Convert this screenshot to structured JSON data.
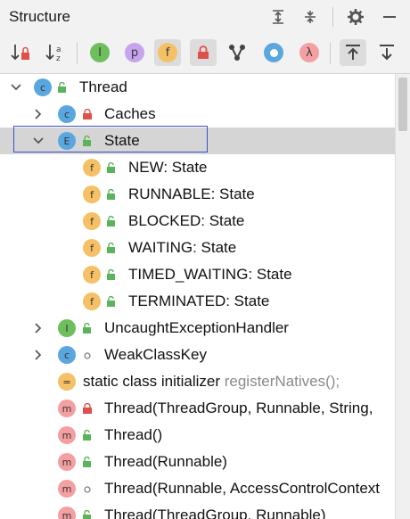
{
  "panel": {
    "title": "Structure"
  },
  "toolbar": {
    "tools": [
      {
        "name": "sort-by-visibility",
        "active": false
      },
      {
        "name": "sort-alphabetically",
        "active": false
      },
      {
        "name": "show-inherited",
        "glyph": "I",
        "color": "#6cbf5c",
        "active": false
      },
      {
        "name": "show-properties",
        "glyph": "p",
        "color": "#c7a4ee",
        "active": false
      },
      {
        "name": "show-fields",
        "glyph": "f",
        "color": "#f5c066",
        "active": true
      },
      {
        "name": "show-non-public",
        "active": true
      },
      {
        "name": "group-by-tree",
        "active": false
      },
      {
        "name": "show-anonymous",
        "active": false
      },
      {
        "name": "show-lambdas",
        "glyph": "λ",
        "color": "#f4a0a3",
        "active": false
      },
      {
        "name": "autoscroll-to-source",
        "active": true
      },
      {
        "name": "autoscroll-from-source",
        "active": false
      }
    ]
  },
  "tree": [
    {
      "label": "Thread",
      "hint": "",
      "badge": "C",
      "visibility": "public",
      "expand": "open"
    },
    {
      "label": "Caches",
      "hint": "",
      "badge": "C",
      "visibility": "private",
      "expand": "closed"
    },
    {
      "label": "State",
      "hint": "",
      "badge": "E",
      "visibility": "public",
      "expand": "open"
    },
    {
      "label": "NEW: State",
      "hint": "",
      "badge": "f",
      "visibility": "public",
      "expand": "none"
    },
    {
      "label": "RUNNABLE: State",
      "hint": "",
      "badge": "f",
      "visibility": "public",
      "expand": "none"
    },
    {
      "label": "BLOCKED: State",
      "hint": "",
      "badge": "f",
      "visibility": "public",
      "expand": "none"
    },
    {
      "label": "WAITING: State",
      "hint": "",
      "badge": "f",
      "visibility": "public",
      "expand": "none"
    },
    {
      "label": "TIMED_WAITING: State",
      "hint": "",
      "badge": "f",
      "visibility": "public",
      "expand": "none"
    },
    {
      "label": "TERMINATED: State",
      "hint": "",
      "badge": "f",
      "visibility": "public",
      "expand": "none"
    },
    {
      "label": "UncaughtExceptionHandler",
      "hint": "",
      "badge": "I",
      "visibility": "public",
      "expand": "closed"
    },
    {
      "label": "WeakClassKey",
      "hint": "",
      "badge": "C",
      "visibility": "package",
      "expand": "closed"
    },
    {
      "label": "static class initializer",
      "hint": "registerNatives();",
      "badge": "=",
      "visibility": "none",
      "expand": "none"
    },
    {
      "label": "Thread(ThreadGroup, Runnable, String,",
      "hint": "",
      "badge": "m",
      "visibility": "private",
      "expand": "none"
    },
    {
      "label": "Thread()",
      "hint": "",
      "badge": "m",
      "visibility": "public",
      "expand": "none"
    },
    {
      "label": "Thread(Runnable)",
      "hint": "",
      "badge": "m",
      "visibility": "public",
      "expand": "none"
    },
    {
      "label": "Thread(Runnable, AccessControlContext",
      "hint": "",
      "badge": "m",
      "visibility": "package",
      "expand": "none"
    },
    {
      "label": "Thread(ThreadGroup, Runnable)",
      "hint": "",
      "badge": "m",
      "visibility": "public",
      "expand": "none"
    }
  ]
}
